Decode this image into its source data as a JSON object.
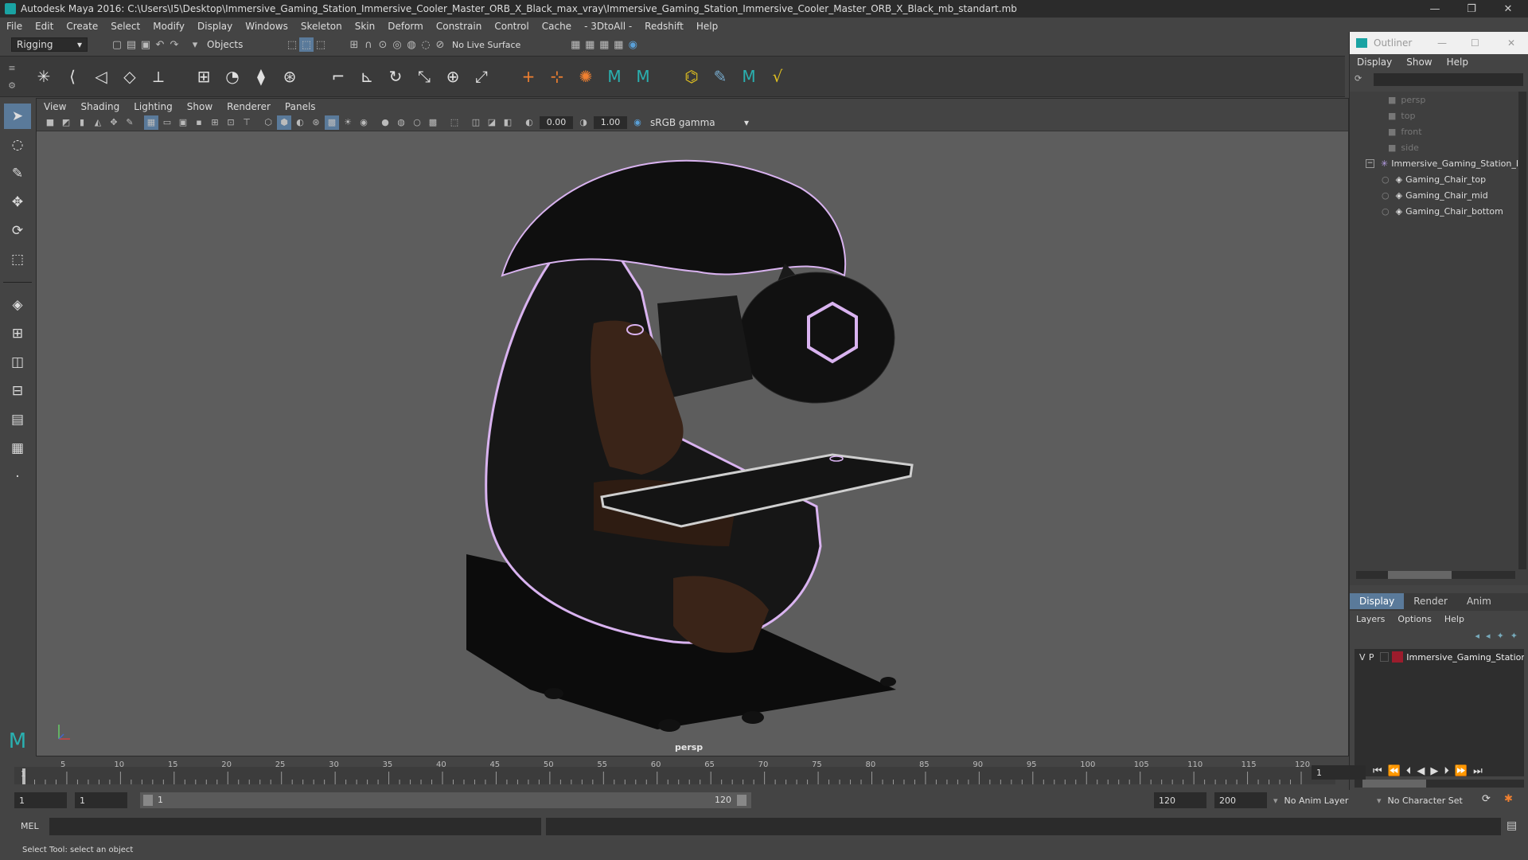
{
  "window": {
    "title": "Autodesk Maya 2016: C:\\Users\\I5\\Desktop\\Immersive_Gaming_Station_Immersive_Cooler_Master_ORB_X_Black_max_vray\\Immersive_Gaming_Station_Immersive_Cooler_Master_ORB_X_Black_mb_standart.mb",
    "minimize": "—",
    "restore": "❐",
    "close": "✕"
  },
  "menubar": [
    "File",
    "Edit",
    "Create",
    "Select",
    "Modify",
    "Display",
    "Windows",
    "Skeleton",
    "Skin",
    "Deform",
    "Constrain",
    "Control",
    "Cache",
    "- 3DtoAll -",
    "Redshift",
    "Help"
  ],
  "statusline": {
    "mode": "Rigging",
    "selection_mask": "Objects",
    "live_surface": "No Live Surface"
  },
  "viewport": {
    "menu": [
      "View",
      "Shading",
      "Lighting",
      "Show",
      "Renderer",
      "Panels"
    ],
    "exposure": "0.00",
    "gamma": "1.00",
    "color_space": "sRGB gamma",
    "camera_label": "persp"
  },
  "outliner": {
    "title": "Outliner",
    "menu": [
      "Display",
      "Show",
      "Help"
    ],
    "items": [
      {
        "label": "persp",
        "type": "camera"
      },
      {
        "label": "top",
        "type": "camera"
      },
      {
        "label": "front",
        "type": "camera"
      },
      {
        "label": "side",
        "type": "camera"
      },
      {
        "label": "Immersive_Gaming_Station_I",
        "type": "group"
      },
      {
        "label": "Gaming_Chair_top",
        "type": "mesh"
      },
      {
        "label": "Gaming_Chair_mid",
        "type": "mesh"
      },
      {
        "label": "Gaming_Chair_bottom",
        "type": "mesh"
      }
    ]
  },
  "layers": {
    "tabs": [
      "Display",
      "Render",
      "Anim"
    ],
    "menu": [
      "Layers",
      "Options",
      "Help"
    ],
    "layer": {
      "v": "V",
      "p": "P",
      "name": "Immersive_Gaming_Station_I",
      "color": "#9c1c2c"
    }
  },
  "timeline": {
    "ticks": [
      "5",
      "10",
      "15",
      "20",
      "25",
      "30",
      "35",
      "40",
      "45",
      "50",
      "55",
      "60",
      "65",
      "70",
      "75",
      "80",
      "85",
      "90",
      "95",
      "100",
      "105",
      "110",
      "115",
      "120"
    ],
    "first_tick": "1",
    "current_frame": "1"
  },
  "range": {
    "start": "1",
    "anim_start": "1",
    "slider_start": "1",
    "slider_end": "120",
    "anim_end": "120",
    "end": "200",
    "anim_layer": "No Anim Layer",
    "character_set": "No Character Set"
  },
  "cmdline": {
    "label": "MEL"
  },
  "helpline": {
    "text": "Select Tool: select an object"
  },
  "colors": {
    "accent": "#5aa0d8",
    "layer": "#9c1c2c",
    "trim": "#d9b3f0"
  }
}
